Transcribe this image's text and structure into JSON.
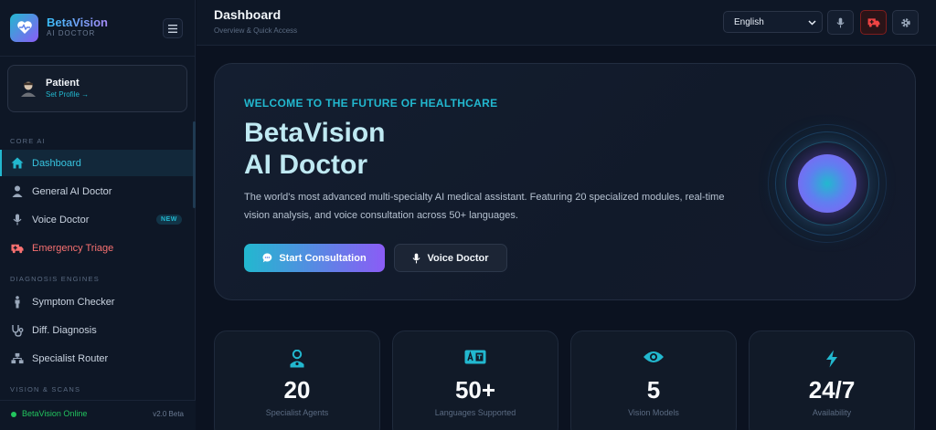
{
  "brand": {
    "name": "BetaVision",
    "subtitle": "AI DOCTOR"
  },
  "patient": {
    "name": "Patient",
    "link": "Set Profile →"
  },
  "sidebar": {
    "sections": [
      "CORE AI",
      "DIAGNOSIS ENGINES",
      "VISION & SCANS"
    ],
    "core_items": [
      {
        "label": "Dashboard",
        "icon": "home-icon"
      },
      {
        "label": "General AI Doctor",
        "icon": "doctor-icon"
      },
      {
        "label": "Voice Doctor",
        "icon": "microphone-icon",
        "badge": "NEW"
      },
      {
        "label": "Emergency Triage",
        "icon": "ambulance-icon"
      }
    ],
    "diagnosis_items": [
      {
        "label": "Symptom Checker",
        "icon": "person-icon"
      },
      {
        "label": "Diff. Diagnosis",
        "icon": "stethoscope-icon"
      },
      {
        "label": "Specialist Router",
        "icon": "network-icon"
      }
    ],
    "status": "BetaVision Online",
    "version": "v2.0 Beta"
  },
  "header": {
    "title": "Dashboard",
    "subtitle": "Overview & Quick Access",
    "language": "English"
  },
  "hero": {
    "eyebrow": "WELCOME TO THE FUTURE OF HEALTHCARE",
    "title_line1": "BetaVision",
    "title_line2": "AI Doctor",
    "description": "The world's most advanced multi-specialty AI medical assistant. Featuring 20 specialized modules, real-time vision analysis, and voice consultation across 50+ languages.",
    "primary_button": "Start Consultation",
    "secondary_button": "Voice Doctor"
  },
  "stats": [
    {
      "value": "20",
      "label": "Specialist Agents",
      "icon": "doctor-icon"
    },
    {
      "value": "50+",
      "label": "Languages Supported",
      "icon": "translate-icon"
    },
    {
      "value": "5",
      "label": "Vision Models",
      "icon": "eye-icon"
    },
    {
      "value": "24/7",
      "label": "Availability",
      "icon": "bolt-icon"
    }
  ],
  "colors": {
    "accent": "#22b8cf",
    "brand_purple": "#8b5cf6",
    "danger": "#f87171",
    "online": "#22c55e"
  }
}
